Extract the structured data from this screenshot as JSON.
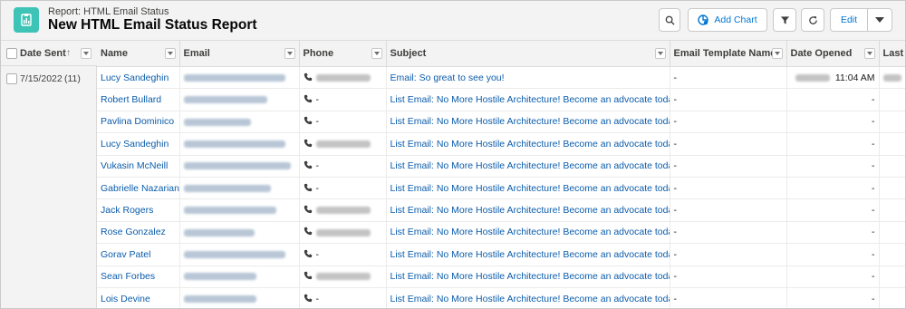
{
  "header": {
    "eyebrow": "Report: HTML Email Status",
    "title": "New HTML Email Status Report",
    "add_chart_label": "Add Chart",
    "edit_label": "Edit"
  },
  "group": {
    "header_label": "Date Sent",
    "sort_indicator": "↑",
    "rows": [
      {
        "date": "7/15/2022",
        "count": "(11)"
      }
    ]
  },
  "columns": {
    "name": "Name",
    "email": "Email",
    "phone": "Phone",
    "subject": "Subject",
    "template": "Email Template Name",
    "opened": "Date Opened",
    "last": "Last"
  },
  "rows": [
    {
      "name": "Lucy Sandeghin",
      "email": "redacted",
      "phone": "redacted",
      "subject": "Email: So great to see you!",
      "template": "-",
      "opened_time": "11:04 AM",
      "opened_date": "redacted",
      "last": "redacted"
    },
    {
      "name": "Robert Bullard",
      "email": "redacted",
      "phone": "-",
      "subject": "List Email: No More Hostile Architecture! Become an advocate today.",
      "template": "-",
      "opened": "-",
      "last": "-"
    },
    {
      "name": "Pavlina Dominico",
      "email": "redacted",
      "phone": "-",
      "subject": "List Email: No More Hostile Architecture! Become an advocate today.",
      "template": "-",
      "opened": "-",
      "last": "-"
    },
    {
      "name": "Lucy Sandeghin",
      "email": "redacted",
      "phone": "redacted",
      "subject": "List Email: No More Hostile Architecture! Become an advocate today.",
      "template": "-",
      "opened": "-",
      "last": "-"
    },
    {
      "name": "Vukasin McNeill",
      "email": "redacted",
      "phone": "-",
      "subject": "List Email: No More Hostile Architecture! Become an advocate today.",
      "template": "-",
      "opened": "-",
      "last": "-"
    },
    {
      "name": "Gabrielle Nazarian",
      "email": "redacted",
      "phone": "-",
      "subject": "List Email: No More Hostile Architecture! Become an advocate today.",
      "template": "-",
      "opened": "-",
      "last": "-"
    },
    {
      "name": "Jack Rogers",
      "email": "redacted",
      "phone": "redacted",
      "subject": "List Email: No More Hostile Architecture! Become an advocate today.",
      "template": "-",
      "opened": "-",
      "last": "-"
    },
    {
      "name": "Rose Gonzalez",
      "email": "redacted",
      "phone": "redacted",
      "subject": "List Email: No More Hostile Architecture! Become an advocate today.",
      "template": "-",
      "opened": "-",
      "last": "-"
    },
    {
      "name": "Gorav Patel",
      "email": "redacted",
      "phone": "-",
      "subject": "List Email: No More Hostile Architecture! Become an advocate today.",
      "template": "-",
      "opened": "-",
      "last": "-"
    },
    {
      "name": "Sean Forbes",
      "email": "redacted",
      "phone": "redacted",
      "subject": "List Email: No More Hostile Architecture! Become an advocate today.",
      "template": "-",
      "opened": "-",
      "last": "-"
    },
    {
      "name": "Lois Devine",
      "email": "redacted",
      "phone": "-",
      "subject": "List Email: No More Hostile Architecture! Become an advocate today.",
      "template": "-",
      "opened": "-",
      "last": "-"
    }
  ],
  "colors": {
    "accent": "#0176d3",
    "link": "#0b5cab",
    "report_icon": "#3ec3b7",
    "header_bg": "#f3f3f3"
  },
  "icons": {
    "report": "report-icon",
    "search": "search-icon",
    "add_chart": "chart-icon",
    "filter": "filter-icon",
    "refresh": "refresh-icon",
    "menu": "chevron-down-icon",
    "phone": "phone-icon"
  }
}
